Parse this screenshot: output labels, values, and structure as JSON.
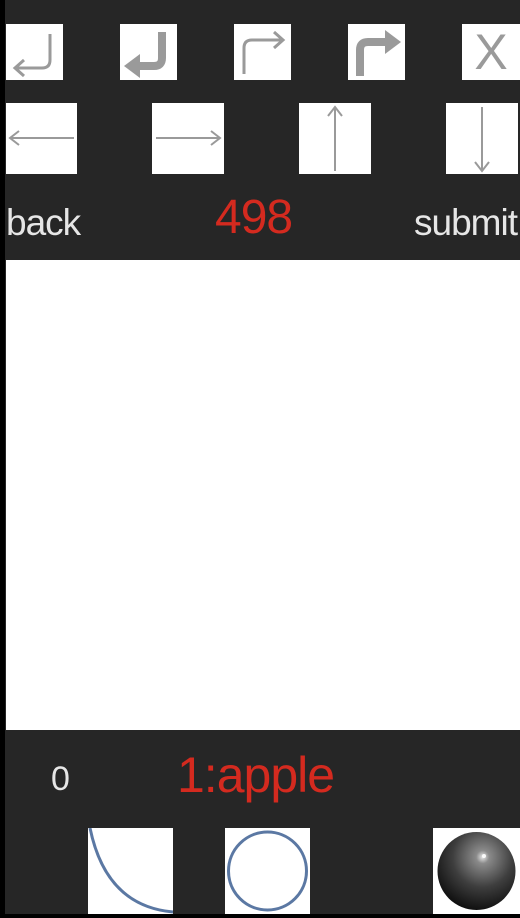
{
  "toolbar": {
    "icons": {
      "undo": "return-arrow-thin-icon",
      "undo_bold": "return-arrow-bold-icon",
      "redo": "redo-arrow-thin-icon",
      "redo_bold": "redo-arrow-bold-icon",
      "close": "x-icon"
    },
    "close_label": "X"
  },
  "nav": {
    "icons": [
      "arrow-left-icon",
      "arrow-right-icon",
      "arrow-up-icon",
      "arrow-down-icon"
    ]
  },
  "header": {
    "back_label": "back",
    "counter": "498",
    "submit_label": "submit"
  },
  "footer": {
    "score": "0",
    "prompt": "1:apple"
  },
  "palette": {
    "items": [
      "arc-icon",
      "circle-outline-icon",
      "sphere-icon"
    ]
  },
  "colors": {
    "background": "#262626",
    "accent": "#d42a1f",
    "text_light": "#e6e6e6",
    "icon_gray": "#9a9a9a",
    "stroke_blue": "#5b78a3"
  }
}
